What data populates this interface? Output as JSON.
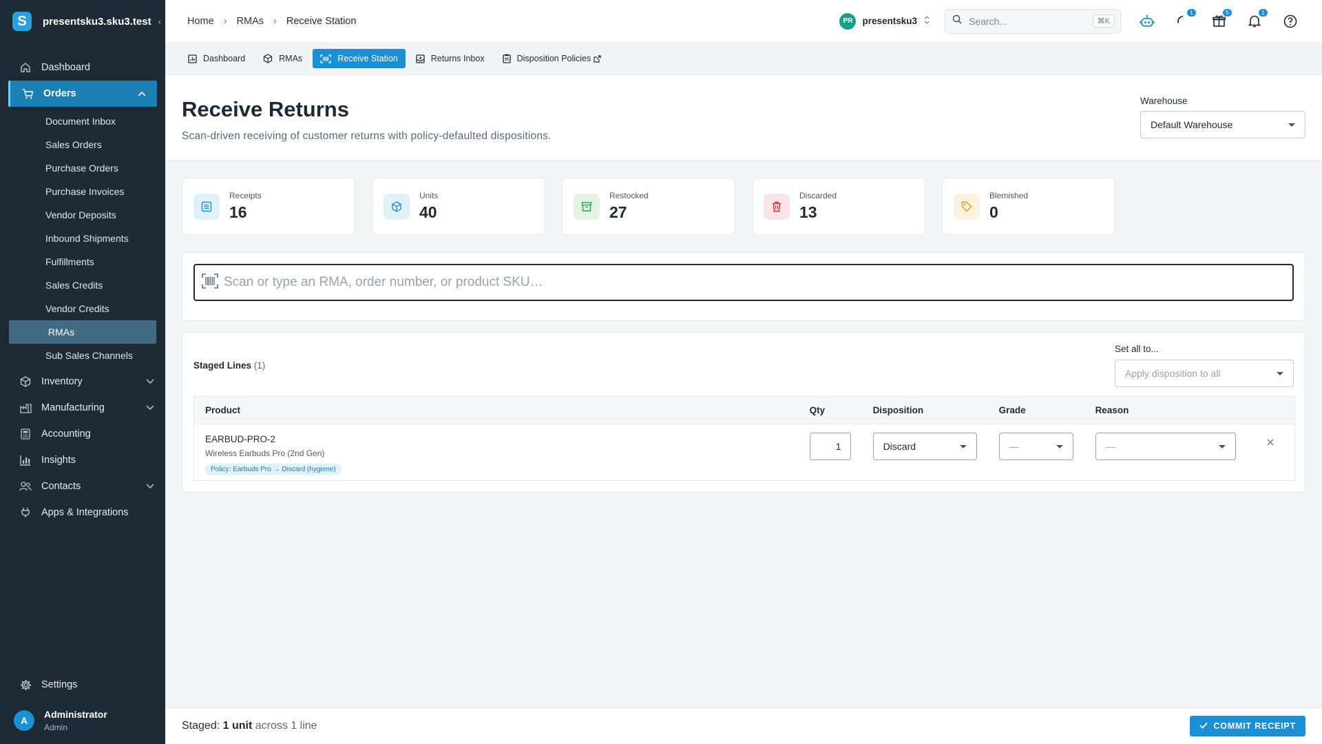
{
  "app": {
    "workspace": "presentsku3.sku3.test",
    "logo_letter": "S"
  },
  "sidebar": {
    "items": [
      {
        "label": "Dashboard",
        "icon": "home-icon"
      },
      {
        "label": "Orders",
        "icon": "cart-icon",
        "expanded": true
      },
      {
        "label": "Inventory",
        "icon": "box-icon"
      },
      {
        "label": "Manufacturing",
        "icon": "factory-icon"
      },
      {
        "label": "Accounting",
        "icon": "calculator-icon"
      },
      {
        "label": "Insights",
        "icon": "bar-chart-icon"
      },
      {
        "label": "Contacts",
        "icon": "contacts-icon"
      },
      {
        "label": "Apps & Integrations",
        "icon": "plug-icon"
      }
    ],
    "orders_sub": [
      "Document Inbox",
      "Sales Orders",
      "Purchase Orders",
      "Purchase Invoices",
      "Vendor Deposits",
      "Inbound Shipments",
      "Fulfillments",
      "Sales Credits",
      "Vendor Credits",
      "RMAs",
      "Sub Sales Channels"
    ],
    "selected_sub": "RMAs",
    "settings": "Settings",
    "user": {
      "initial": "A",
      "name": "Administrator",
      "role": "Admin"
    }
  },
  "header": {
    "breadcrumb": [
      "Home",
      "RMAs",
      "Receive Station"
    ],
    "org": {
      "initials": "PR",
      "name": "presentsku3"
    },
    "search": {
      "placeholder": "Search...",
      "shortcut": "⌘K"
    },
    "badges": {
      "tasks": "1",
      "gifts": "5",
      "notifications": "1"
    }
  },
  "tabs": [
    {
      "label": "Dashboard",
      "icon": "dashboard-icon"
    },
    {
      "label": "RMAs",
      "icon": "package-return-icon"
    },
    {
      "label": "Receive Station",
      "icon": "barcode-scan-icon",
      "active": true
    },
    {
      "label": "Returns Inbox",
      "icon": "inbox-icon"
    },
    {
      "label": "Disposition Policies",
      "icon": "clipboard-icon",
      "external": true
    }
  ],
  "page": {
    "title": "Receive Returns",
    "subtitle": "Scan-driven receiving of customer returns with policy-defaulted dispositions.",
    "warehouse_label": "Warehouse",
    "warehouse_value": "Default Warehouse"
  },
  "stats": [
    {
      "label": "Receipts",
      "value": "16",
      "icon": "list-icon",
      "color": "#1b8fd4"
    },
    {
      "label": "Units",
      "value": "40",
      "icon": "cube-icon",
      "color": "#1b8fd4"
    },
    {
      "label": "Restocked",
      "value": "27",
      "icon": "archive-icon",
      "color": "#2e9b4f"
    },
    {
      "label": "Discarded",
      "value": "13",
      "icon": "trash-icon",
      "color": "#d12b3a"
    },
    {
      "label": "Blemished",
      "value": "0",
      "icon": "tag-icon",
      "color": "#e39a1e"
    }
  ],
  "scan": {
    "placeholder": "Scan or type an RMA, order number, or product SKU…"
  },
  "staged": {
    "title": "Staged Lines",
    "count": "(1)",
    "set_all_label": "Set all to...",
    "set_all_placeholder": "Apply disposition to all",
    "columns": [
      "Product",
      "Qty",
      "Disposition",
      "Grade",
      "Reason"
    ],
    "rows": [
      {
        "sku": "EARBUD-PRO-2",
        "name": "Wireless Earbuds Pro (2nd Gen)",
        "policy": "Policy: Earbuds Pro → Discard (hygiene)",
        "qty": "1",
        "disposition": "Discard",
        "grade": "—",
        "reason": "—"
      }
    ]
  },
  "footer": {
    "prefix": "Staged:",
    "units": "1 unit",
    "suffix": "across 1 line",
    "commit_label": "COMMIT RECEIPT"
  }
}
